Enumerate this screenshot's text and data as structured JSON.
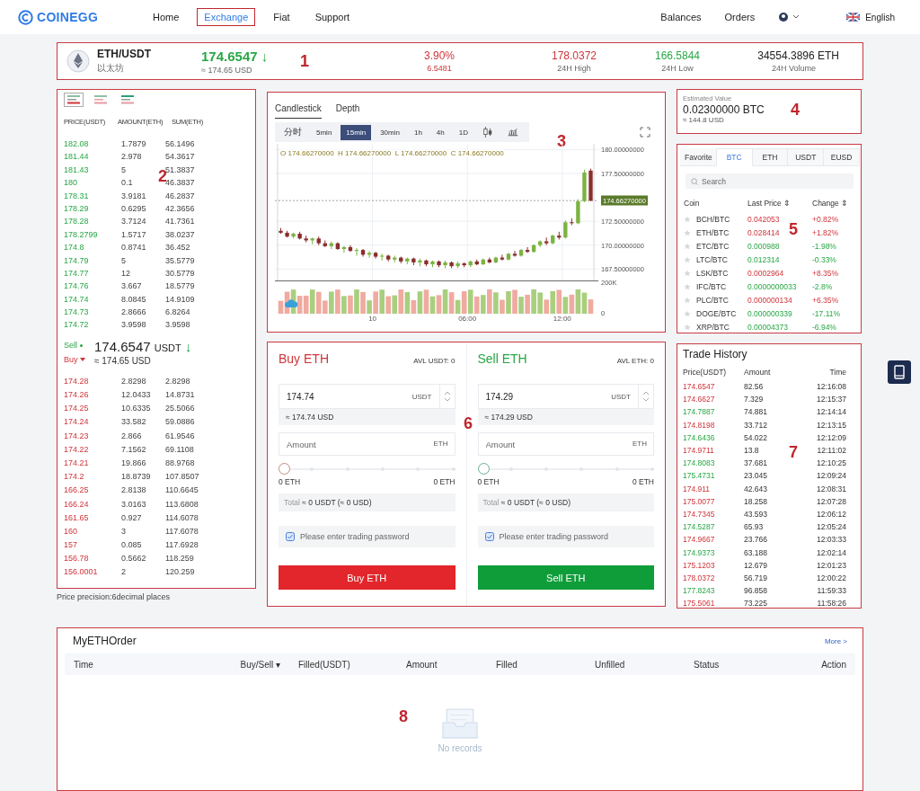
{
  "header": {
    "logo": "COINEGG",
    "nav": [
      {
        "label": "Home",
        "selected": false
      },
      {
        "label": "Exchange",
        "selected": true
      },
      {
        "label": "Fiat",
        "selected": false
      },
      {
        "label": "Support",
        "selected": false
      }
    ],
    "links": [
      "Balances",
      "Orders"
    ],
    "language": "English"
  },
  "ticker": {
    "annotation": "1",
    "pair": "ETH/USDT",
    "name": "以太坊",
    "price": "174.6547",
    "arrow": "↓",
    "price_usd": "≈ 174.65 USD",
    "stats": [
      {
        "value": "3.90%",
        "label": "6.5481",
        "color": "#d0343a"
      },
      {
        "value": "178.0372",
        "label": "24H High",
        "color": "#d0343a"
      },
      {
        "value": "166.5844",
        "label": "24H Low",
        "color": "#28a745"
      },
      {
        "value": "34554.3896 ETH",
        "label": "24H Volume",
        "color": "#222222"
      }
    ]
  },
  "order_book": {
    "annotation": "2",
    "views": [
      {
        "selected": true
      },
      {
        "selected": false
      },
      {
        "selected": false
      }
    ],
    "columns": [
      "PRICE(USDT)",
      "AMOUNT(ETH)",
      "SUM(ETH)"
    ],
    "asks": [
      {
        "price": "182.08",
        "amount": "1.7879",
        "sum": "56.1496"
      },
      {
        "price": "181.44",
        "amount": "2.978",
        "sum": "54.3617"
      },
      {
        "price": "181.43",
        "amount": "5",
        "sum": "51.3837"
      },
      {
        "price": "180",
        "amount": "0.1",
        "sum": "46.3837"
      },
      {
        "price": "178.31",
        "amount": "3.9181",
        "sum": "46.2837"
      },
      {
        "price": "178.29",
        "amount": "0.6295",
        "sum": "42.3656"
      },
      {
        "price": "178.28",
        "amount": "3.7124",
        "sum": "41.7361"
      },
      {
        "price": "178.2799",
        "amount": "1.5717",
        "sum": "38.0237"
      },
      {
        "price": "174.8",
        "amount": "0.8741",
        "sum": "36.452"
      },
      {
        "price": "174.79",
        "amount": "5",
        "sum": "35.5779"
      },
      {
        "price": "174.77",
        "amount": "12",
        "sum": "30.5779"
      },
      {
        "price": "174.76",
        "amount": "3.667",
        "sum": "18.5779"
      },
      {
        "price": "174.74",
        "amount": "8.0845",
        "sum": "14.9109"
      },
      {
        "price": "174.73",
        "amount": "2.8666",
        "sum": "6.8264"
      },
      {
        "price": "174.72",
        "amount": "3.9598",
        "sum": "3.9598"
      }
    ],
    "sell_label": "Sell",
    "buy_label": "Buy",
    "last_price": "174.6547",
    "last_unit": "USDT",
    "last_arrow": "↓",
    "last_usd": "≈ 174.65 USD",
    "bids": [
      {
        "price": "174.28",
        "amount": "2.8298",
        "sum": "2.8298"
      },
      {
        "price": "174.26",
        "amount": "12.0433",
        "sum": "14.8731"
      },
      {
        "price": "174.25",
        "amount": "10.6335",
        "sum": "25.5066"
      },
      {
        "price": "174.24",
        "amount": "33.582",
        "sum": "59.0886"
      },
      {
        "price": "174.23",
        "amount": "2.866",
        "sum": "61.9546"
      },
      {
        "price": "174.22",
        "amount": "7.1562",
        "sum": "69.1108"
      },
      {
        "price": "174.21",
        "amount": "19.866",
        "sum": "88.9768"
      },
      {
        "price": "174.2",
        "amount": "18.8739",
        "sum": "107.8507"
      },
      {
        "price": "166.25",
        "amount": "2.8138",
        "sum": "110.6645"
      },
      {
        "price": "166.24",
        "amount": "3.0163",
        "sum": "113.6808"
      },
      {
        "price": "161.65",
        "amount": "0.927",
        "sum": "114.6078"
      },
      {
        "price": "160",
        "amount": "3",
        "sum": "117.6078"
      },
      {
        "price": "157",
        "amount": "0.085",
        "sum": "117.6928"
      },
      {
        "price": "156.78",
        "amount": "0.5662",
        "sum": "118.259"
      },
      {
        "price": "156.0001",
        "amount": "2",
        "sum": "120.259"
      }
    ],
    "precision": "Price precision:6decimal places"
  },
  "chart": {
    "annotation": "3",
    "tabs": [
      {
        "label": "Candlestick",
        "selected": true
      },
      {
        "label": "Depth",
        "selected": false
      }
    ],
    "intervals": [
      {
        "label": "分时",
        "selected": false
      },
      {
        "label": "5min",
        "selected": false
      },
      {
        "label": "15min",
        "selected": true
      },
      {
        "label": "30min",
        "selected": false
      },
      {
        "label": "1h",
        "selected": false
      },
      {
        "label": "4h",
        "selected": false
      },
      {
        "label": "1D",
        "selected": false
      }
    ],
    "ohlc": "O 174.66270000  H 174.66270000  L 174.66270000  C 174.66270000",
    "volume_labels": [
      "200K",
      "0"
    ],
    "day_label": "10",
    "chart_data": {
      "type": "candlestick",
      "x": [
        -5.8,
        -5.4,
        -5.0,
        -4.6,
        -4.2,
        -3.8,
        -3.4,
        -3.0,
        -2.6,
        -2.2,
        -1.8,
        -1.4,
        -1.0,
        -0.6,
        -0.2,
        0.2,
        0.6,
        1.0,
        1.4,
        1.8,
        2.2,
        2.6,
        3.0,
        3.4,
        3.8,
        4.2,
        4.6,
        5.0,
        5.4,
        5.8,
        6.2,
        6.6,
        7.0,
        7.4,
        7.8,
        8.2,
        8.6,
        9.0,
        9.4,
        9.8,
        10.2,
        10.6,
        11.0,
        11.4,
        11.8,
        12.2,
        12.6,
        13.0,
        13.4,
        13.8
      ],
      "ohlc": [
        [
          171.5,
          171.8,
          171.2,
          171.3
        ],
        [
          171.3,
          171.5,
          170.8,
          170.9
        ],
        [
          170.9,
          171.3,
          170.7,
          171.2
        ],
        [
          171.2,
          171.4,
          170.6,
          170.7
        ],
        [
          170.7,
          171.0,
          170.3,
          170.5
        ],
        [
          170.5,
          170.8,
          170.1,
          170.7
        ],
        [
          170.7,
          170.9,
          170.0,
          170.2
        ],
        [
          170.2,
          170.5,
          169.8,
          169.9
        ],
        [
          169.9,
          170.4,
          169.6,
          170.2
        ],
        [
          170.2,
          170.3,
          169.5,
          169.6
        ],
        [
          169.6,
          169.9,
          169.2,
          169.8
        ],
        [
          169.8,
          170.0,
          169.3,
          169.4
        ],
        [
          169.4,
          169.7,
          168.9,
          169.5
        ],
        [
          169.5,
          169.6,
          168.8,
          169.0
        ],
        [
          169.0,
          169.4,
          168.7,
          169.2
        ],
        [
          169.2,
          169.3,
          168.6,
          168.8
        ],
        [
          168.8,
          169.1,
          168.4,
          168.9
        ],
        [
          168.9,
          169.0,
          168.3,
          168.5
        ],
        [
          168.5,
          168.9,
          168.2,
          168.7
        ],
        [
          168.7,
          168.8,
          168.1,
          168.3
        ],
        [
          168.3,
          168.7,
          168.0,
          168.6
        ],
        [
          168.6,
          168.7,
          167.9,
          168.2
        ],
        [
          168.2,
          168.6,
          167.8,
          168.4
        ],
        [
          168.4,
          168.5,
          167.8,
          168.0
        ],
        [
          168.0,
          168.4,
          167.7,
          168.3
        ],
        [
          168.3,
          168.4,
          167.7,
          167.9
        ],
        [
          167.9,
          168.4,
          167.6,
          168.2
        ],
        [
          168.2,
          168.3,
          167.6,
          167.8
        ],
        [
          167.8,
          168.3,
          167.6,
          168.1
        ],
        [
          168.1,
          168.2,
          167.7,
          167.9
        ],
        [
          167.9,
          168.4,
          167.7,
          168.3
        ],
        [
          168.3,
          168.5,
          167.9,
          168.0
        ],
        [
          168.0,
          168.6,
          167.9,
          168.5
        ],
        [
          168.5,
          168.7,
          168.1,
          168.2
        ],
        [
          168.2,
          168.8,
          168.1,
          168.7
        ],
        [
          168.7,
          169.0,
          168.4,
          168.5
        ],
        [
          168.5,
          169.2,
          168.4,
          169.1
        ],
        [
          169.1,
          169.4,
          168.8,
          168.9
        ],
        [
          168.9,
          169.6,
          168.8,
          169.5
        ],
        [
          169.5,
          169.8,
          169.2,
          169.3
        ],
        [
          169.3,
          170.1,
          169.2,
          170.0
        ],
        [
          170.0,
          170.5,
          169.8,
          170.4
        ],
        [
          170.4,
          170.8,
          170.0,
          170.2
        ],
        [
          170.2,
          171.1,
          170.1,
          171.0
        ],
        [
          171.0,
          171.4,
          170.6,
          170.8
        ],
        [
          170.8,
          172.6,
          170.7,
          172.4
        ],
        [
          172.4,
          172.8,
          172.1,
          172.3
        ],
        [
          172.3,
          174.8,
          172.2,
          174.6
        ],
        [
          174.6,
          177.9,
          174.5,
          177.6
        ],
        [
          177.8,
          178.0,
          174.6,
          174.66
        ]
      ],
      "ylim": [
        166.5,
        180.6
      ],
      "yticks": [
        {
          "value": 180,
          "label": "180.00000000"
        },
        {
          "value": 177.5,
          "label": "177.50000000"
        },
        {
          "value": 172.5,
          "label": "172.50000000"
        },
        {
          "value": 170,
          "label": "170.00000000"
        },
        {
          "value": 167.5,
          "label": "167.50000000"
        }
      ],
      "grid": true,
      "xlim": [
        -6.0,
        14.0
      ],
      "xticks": [
        {
          "value": 6,
          "label": "06:00"
        },
        {
          "value": 12,
          "label": "12:00"
        }
      ],
      "ref_lines": [
        {
          "axis": "y",
          "value": 174.6627,
          "label": "174.66270000"
        }
      ]
    }
  },
  "estimate": {
    "annotation": "4",
    "label": "Estimated Value",
    "value": "0.02300000 BTC",
    "usd": "≈ 144.8 USD"
  },
  "market": {
    "annotation": "5",
    "tabs": [
      {
        "label": "Favorite",
        "selected": false
      },
      {
        "label": "BTC",
        "selected": true
      },
      {
        "label": "ETH",
        "selected": false
      },
      {
        "label": "USDT",
        "selected": false
      },
      {
        "label": "EUSD",
        "selected": false
      }
    ],
    "search_placeholder": "Search",
    "columns": [
      "Coin",
      "Last Price ⇕",
      "Change ⇕"
    ],
    "rows": [
      {
        "pair": "BCH/BTC",
        "price": "0.042053",
        "change": "+0.82%",
        "rising": true,
        "favorite": false
      },
      {
        "pair": "ETH/BTC",
        "price": "0.028414",
        "change": "+1.82%",
        "rising": true,
        "favorite": false
      },
      {
        "pair": "ETC/BTC",
        "price": "0.000988",
        "change": "-1.98%",
        "rising": false,
        "favorite": false
      },
      {
        "pair": "LTC/BTC",
        "price": "0.012314",
        "change": "-0.33%",
        "rising": false,
        "favorite": false
      },
      {
        "pair": "LSK/BTC",
        "price": "0.0002964",
        "change": "+8.35%",
        "rising": true,
        "favorite": false
      },
      {
        "pair": "IFC/BTC",
        "price": "0.0000000033",
        "change": "-2.8%",
        "rising": false,
        "favorite": false
      },
      {
        "pair": "PLC/BTC",
        "price": "0.000000134",
        "change": "+6.35%",
        "rising": true,
        "favorite": false
      },
      {
        "pair": "DOGE/BTC",
        "price": "0.000000339",
        "change": "-17.11%",
        "rising": false,
        "favorite": false
      },
      {
        "pair": "XRP/BTC",
        "price": "0.00004373",
        "change": "-6.94%",
        "rising": false,
        "favorite": false
      }
    ]
  },
  "trade": {
    "annotation": "6",
    "sides": [
      {
        "kind": "buy",
        "title": "Buy ETH",
        "avl": "AVL USDT: 0",
        "price": "174.74",
        "unit": "USDT",
        "approx": "≈ 174.74 USD",
        "amount_placeholder": "Amount",
        "amount_unit": "ETH",
        "level": 0,
        "min": "0 ETH",
        "max": "0 ETH",
        "total_label": "Total",
        "total_value": "≈ 0 USDT (≈ 0 USD)",
        "password_placeholder": "Please enter trading password",
        "button": "Buy ETH"
      },
      {
        "kind": "sell",
        "title": "Sell ETH",
        "avl": "AVL ETH: 0",
        "price": "174.29",
        "unit": "USDT",
        "approx": "≈ 174.29 USD",
        "amount_placeholder": "Amount",
        "amount_unit": "ETH",
        "level": 0,
        "min": "0 ETH",
        "max": "0 ETH",
        "total_label": "Total",
        "total_value": "≈ 0 USDT (≈ 0 USD)",
        "password_placeholder": "Please enter trading password",
        "button": "Sell ETH"
      }
    ]
  },
  "history": {
    "annotation": "7",
    "title": "Trade History",
    "columns": [
      "Price(USDT)",
      "Amount",
      "Time"
    ],
    "rows": [
      {
        "price": "174.6547",
        "amount": "82.56",
        "time": "12:16:08",
        "rising": true
      },
      {
        "price": "174.6627",
        "amount": "7.329",
        "time": "12:15:37",
        "rising": true
      },
      {
        "price": "174.7887",
        "amount": "74.881",
        "time": "12:14:14",
        "rising": false
      },
      {
        "price": "174.8198",
        "amount": "33.712",
        "time": "12:13:15",
        "rising": true
      },
      {
        "price": "174.6436",
        "amount": "54.022",
        "time": "12:12:09",
        "rising": false
      },
      {
        "price": "174.9711",
        "amount": "13.8",
        "time": "12:11:02",
        "rising": true
      },
      {
        "price": "174.8083",
        "amount": "37.681",
        "time": "12:10:25",
        "rising": false
      },
      {
        "price": "175.4731",
        "amount": "23.045",
        "time": "12:09:24",
        "rising": false
      },
      {
        "price": "174.911",
        "amount": "42.643",
        "time": "12:08:31",
        "rising": true
      },
      {
        "price": "175.0077",
        "amount": "18.258",
        "time": "12:07:28",
        "rising": true
      },
      {
        "price": "174.7345",
        "amount": "43.593",
        "time": "12:06:12",
        "rising": true
      },
      {
        "price": "174.5287",
        "amount": "65.93",
        "time": "12:05:24",
        "rising": false
      },
      {
        "price": "174.9667",
        "amount": "23.766",
        "time": "12:03:33",
        "rising": true
      },
      {
        "price": "174.9373",
        "amount": "63.188",
        "time": "12:02:14",
        "rising": false
      },
      {
        "price": "175.1203",
        "amount": "12.679",
        "time": "12:01:23",
        "rising": true
      },
      {
        "price": "178.0372",
        "amount": "56.719",
        "time": "12:00:22",
        "rising": true
      },
      {
        "price": "177.8243",
        "amount": "96.858",
        "time": "11:59:33",
        "rising": false
      },
      {
        "price": "175.5061",
        "amount": "73.225",
        "time": "11:58:26",
        "rising": true
      }
    ]
  },
  "orders": {
    "annotation": "8",
    "title": "MyETHOrder",
    "more": "More >",
    "columns": [
      "Time",
      "Buy/Sell ▾",
      "Filled(USDT)",
      "Amount",
      "Filled",
      "Unfilled",
      "Status",
      "Action"
    ],
    "empty": "No records"
  }
}
